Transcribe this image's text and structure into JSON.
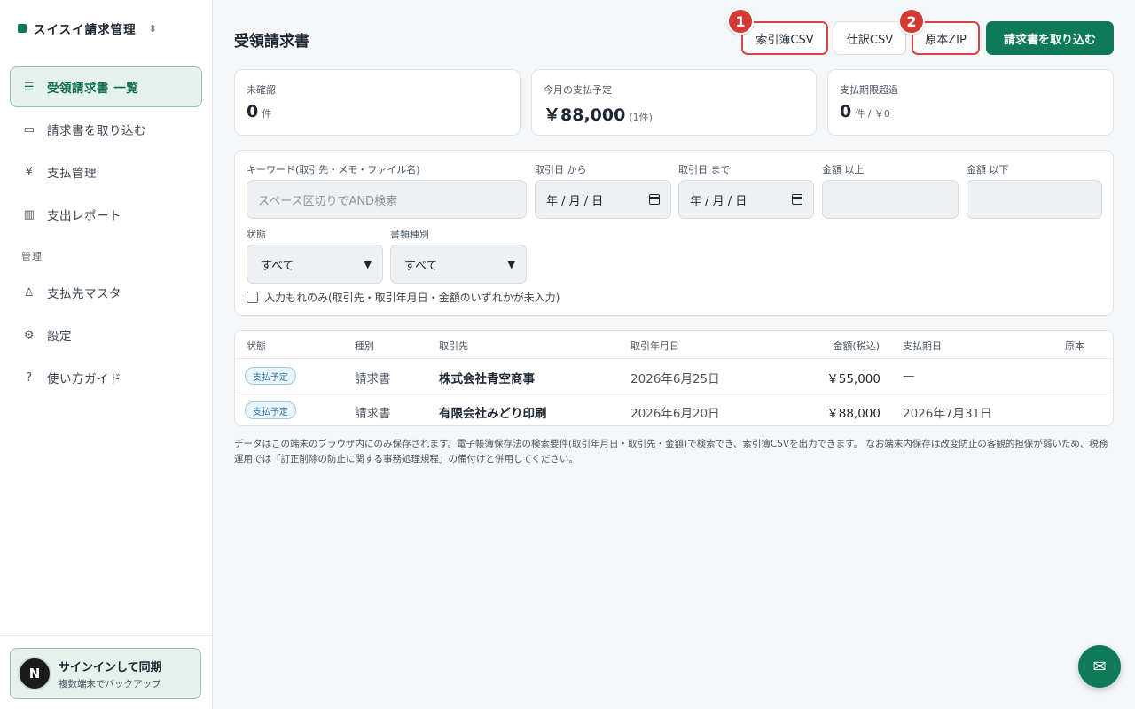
{
  "app": {
    "brand": "スイスイ請求管理",
    "brand_chevron": "⌃⌄"
  },
  "sidebar": {
    "items": [
      {
        "label": "受領請求書 一覧",
        "icon": "list-icon",
        "active": true
      },
      {
        "label": "請求書を取り込む",
        "icon": "inbox-icon"
      },
      {
        "label": "支払管理",
        "icon": "yen-icon"
      },
      {
        "label": "支出レポート",
        "icon": "bar-chart-icon"
      }
    ],
    "section_label": "管理",
    "admin_items": [
      {
        "label": "支払先マスタ",
        "icon": "user-icon"
      },
      {
        "label": "設定",
        "icon": "gear-icon"
      },
      {
        "label": "使い方ガイド",
        "icon": "help-icon"
      }
    ],
    "signin": {
      "avatar_letter": "N",
      "title": "サインインして同期",
      "subtitle": "複数端末でバックアップ"
    }
  },
  "header": {
    "title": "受領請求書",
    "buttons": {
      "index_csv": "索引簿CSV",
      "journal_csv": "仕訳CSV",
      "original_zip": "原本ZIP",
      "import": "請求書を取り込む"
    },
    "badges": {
      "one": "1",
      "two": "2"
    }
  },
  "stats": [
    {
      "label": "未確認",
      "value": "0",
      "unit": "件"
    },
    {
      "label": "今月の支払予定",
      "value": "￥88,000",
      "unit": "(1件)"
    },
    {
      "label": "支払期限超過",
      "value": "0",
      "unit": "件 / ￥0"
    }
  ],
  "filters": {
    "keyword_label": "キーワード(取引先・メモ・ファイル名)",
    "keyword_placeholder": "スペース区切りでAND検索",
    "date_from_label": "取引日 から",
    "date_to_label": "取引日 まで",
    "date_placeholder": "年 / 月 / 日",
    "amount_min_label": "金額 以上",
    "amount_max_label": "金額 以下",
    "status_label": "状態",
    "status_value": "すべて",
    "doctype_label": "書類種別",
    "doctype_value": "すべて",
    "checkbox_label": "入力もれのみ(取引先・取引年月日・金額のいずれかが未入力)"
  },
  "table": {
    "headers": {
      "status": "状態",
      "type": "種別",
      "partner": "取引先",
      "date": "取引年月日",
      "amount": "金額(税込)",
      "due": "支払期日",
      "original": "原本"
    },
    "rows": [
      {
        "status": "支払予定",
        "type": "請求書",
        "partner": "株式会社青空商事",
        "date": "2026年6月25日",
        "amount": "￥55,000",
        "due": "—"
      },
      {
        "status": "支払予定",
        "type": "請求書",
        "partner": "有限会社みどり印刷",
        "date": "2026年6月20日",
        "amount": "￥88,000",
        "due": "2026年7月31日"
      }
    ]
  },
  "note": "データはこの端末のブラウザ内にのみ保存されます。電子帳簿保存法の検索要件(取引年月日・取引先・金額)で検索でき、索引簿CSVを出力できます。 なお端末内保存は改変防止の客観的担保が弱いため、税務運用では「訂正削除の防止に関する事務処理規程」の備付けと併用してください。",
  "colors": {
    "brand": "#0f7a58",
    "highlight": "#d64541",
    "status_pill": "#2a77a8"
  },
  "chat": {
    "icon": "chat-icon"
  }
}
